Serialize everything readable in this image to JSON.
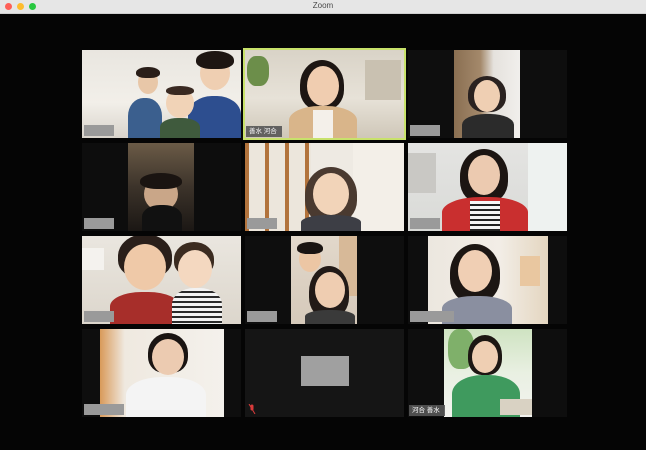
{
  "window": {
    "title": "Zoom"
  },
  "participants": [
    {
      "label": ""
    },
    {
      "label": "善水 河合"
    },
    {
      "label": ""
    },
    {
      "label": ""
    },
    {
      "label": ""
    },
    {
      "label": ""
    },
    {
      "label": ""
    },
    {
      "label": ""
    },
    {
      "label": ""
    },
    {
      "label": ""
    },
    {
      "label": ""
    },
    {
      "label": "河合 善水"
    }
  ],
  "colors": {
    "active_speaker": "#c8e26b",
    "muted": "#d93b3b"
  }
}
